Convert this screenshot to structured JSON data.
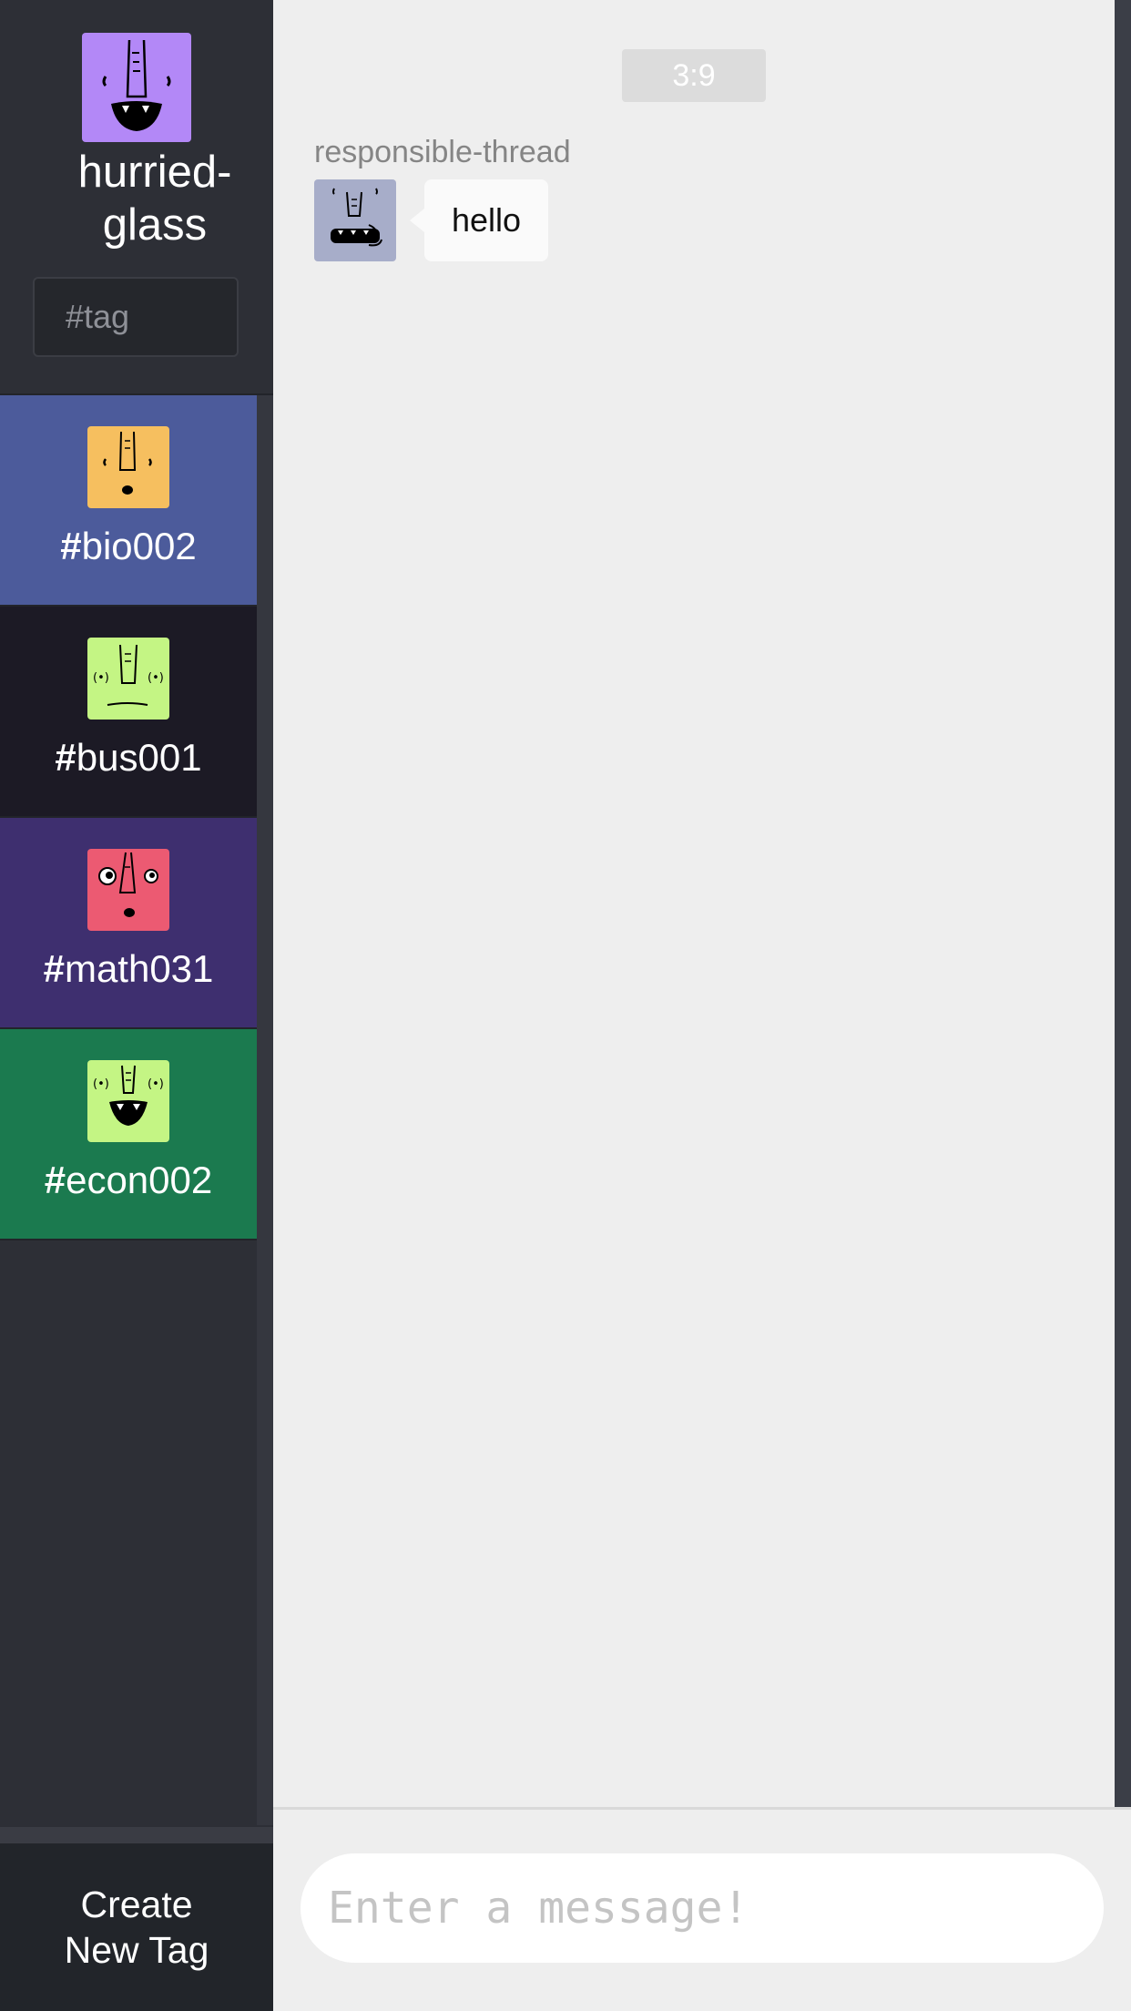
{
  "profile": {
    "username": "hurried-glass",
    "avatar_color": "#b388f7",
    "avatar_icon": "monster-face-icon"
  },
  "tag_search": {
    "placeholder": "#tag"
  },
  "tags": [
    {
      "hash": "#",
      "name": "bio002",
      "bg": "#4c5b9b",
      "avatar_color": "#f6bf5f"
    },
    {
      "hash": "#",
      "name": "bus001",
      "bg": "#1c1a25",
      "avatar_color": "#c4f584"
    },
    {
      "hash": "#",
      "name": "math031",
      "bg": "#3e2f6f",
      "avatar_color": "#ec5a72"
    },
    {
      "hash": "#",
      "name": "econ002",
      "bg": "#1b7a4f",
      "avatar_color": "#c4f584"
    }
  ],
  "create_tag": {
    "label": "Create New Tag"
  },
  "chat": {
    "timestamp": "3:9",
    "messages": [
      {
        "sender": "responsible-thread",
        "text": "hello",
        "avatar_color": "#a7adc9"
      }
    ]
  },
  "composer": {
    "placeholder": "Enter a message!"
  }
}
